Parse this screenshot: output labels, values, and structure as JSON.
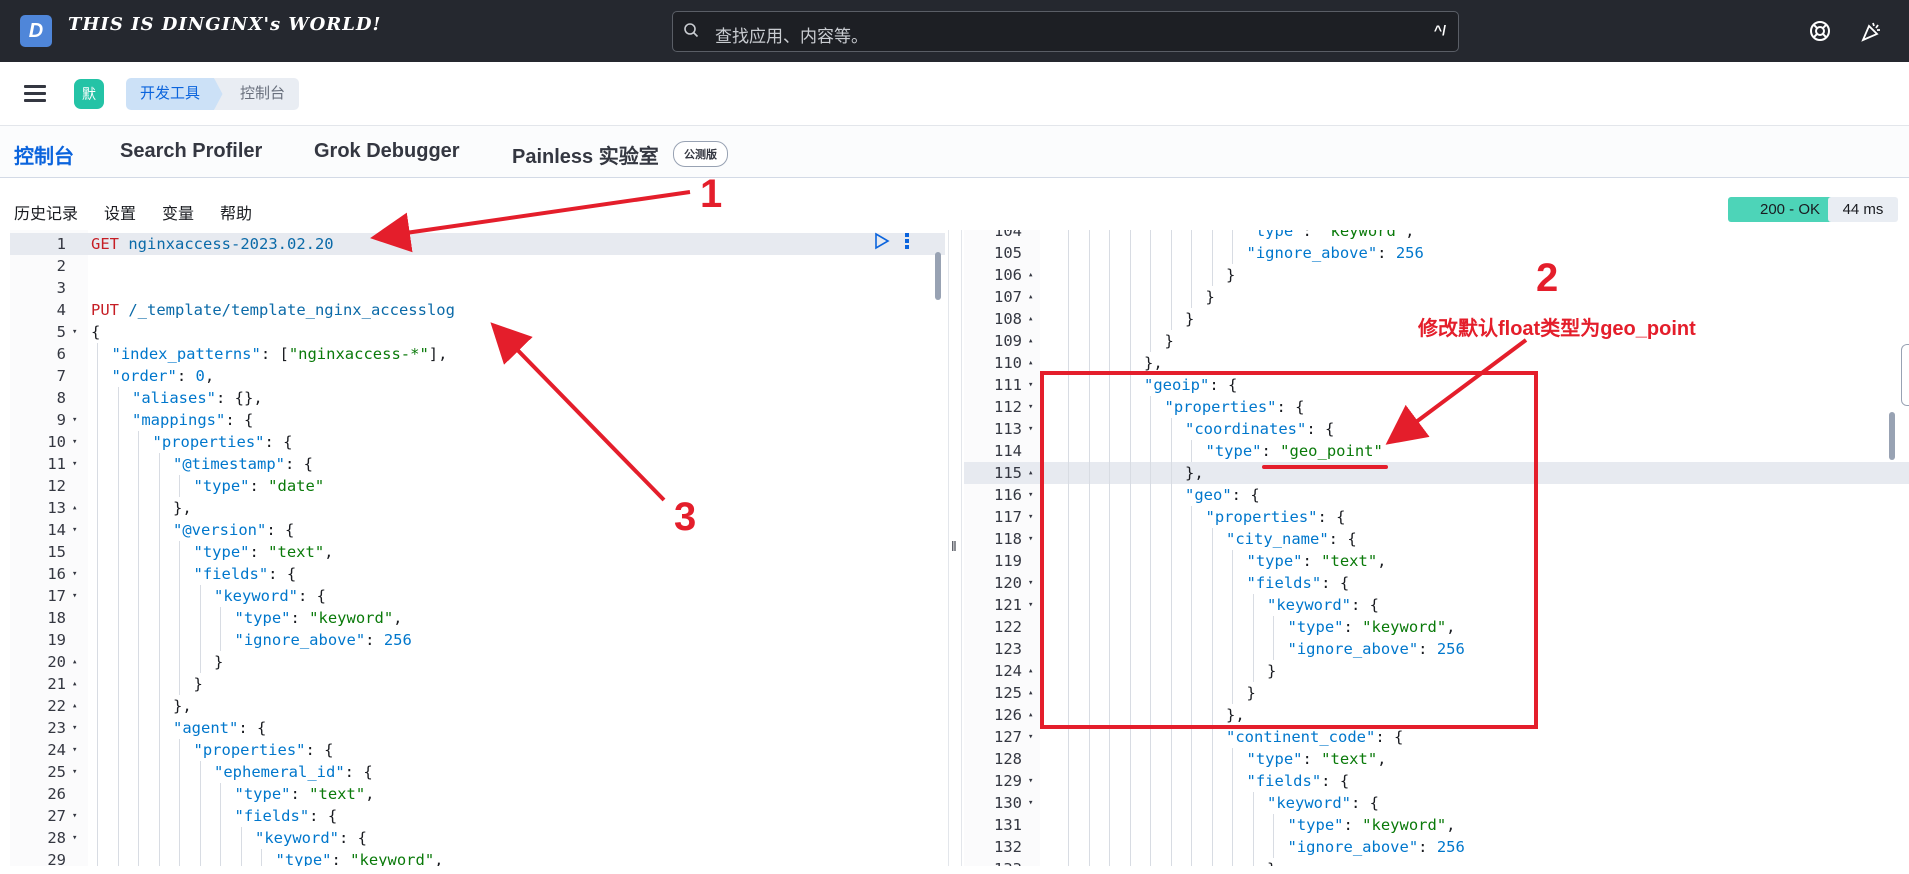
{
  "app": {
    "site_title": "THIS IS DINGINX's WORLD!",
    "logo_letter": "D",
    "search_placeholder": "查找应用、内容等。",
    "search_shortcut": "^/"
  },
  "nav": {
    "avatar": "默",
    "breadcrumbs": [
      "开发工具",
      "控制台"
    ]
  },
  "tabs": [
    {
      "label": "控制台",
      "active": true
    },
    {
      "label": "Search Profiler"
    },
    {
      "label": "Grok Debugger"
    },
    {
      "label": "Painless 实验室"
    }
  ],
  "beta_badge": "公测版",
  "toolbar": {
    "items": [
      "历史记录",
      "设置",
      "变量",
      "帮助"
    ]
  },
  "response": {
    "status": "200 - OK",
    "time": "44 ms"
  },
  "annotations": {
    "one": "1",
    "two": "2",
    "three": "3",
    "note": "修改默认float类型为geo_point"
  },
  "request_lines": [
    {
      "n": "1",
      "fold": "",
      "indent": 0,
      "html": "<span class='m'>GET</span> <span class='p'>nginxaccess-2023.02.20</span>"
    },
    {
      "n": "2",
      "fold": "",
      "indent": 0,
      "html": ""
    },
    {
      "n": "3",
      "fold": "",
      "indent": 0,
      "html": ""
    },
    {
      "n": "4",
      "fold": "",
      "indent": 0,
      "html": "<span class='m'>PUT</span> <span class='p'>/_template/template_nginx_accesslog</span>"
    },
    {
      "n": "5",
      "fold": "▾",
      "indent": 0,
      "html": "{"
    },
    {
      "n": "6",
      "fold": "",
      "indent": 1,
      "html": "<span class='n'>\"index_patterns\"</span>: [<span class='s'>\"nginxaccess-*\"</span>],"
    },
    {
      "n": "7",
      "fold": "",
      "indent": 1,
      "html": "<span class='n'>\"order\"</span>: <span class='n'>0</span>,"
    },
    {
      "n": "8",
      "fold": "",
      "indent": 2,
      "html": "<span class='n'>\"aliases\"</span>: {},"
    },
    {
      "n": "9",
      "fold": "▾",
      "indent": 2,
      "html": "<span class='n'>\"mappings\"</span>: {"
    },
    {
      "n": "10",
      "fold": "▾",
      "indent": 3,
      "html": "<span class='n'>\"properties\"</span>: {"
    },
    {
      "n": "11",
      "fold": "▾",
      "indent": 4,
      "html": "<span class='n'>\"@timestamp\"</span>: {"
    },
    {
      "n": "12",
      "fold": "",
      "indent": 5,
      "html": "<span class='n'>\"type\"</span>: <span class='s'>\"date\"</span>"
    },
    {
      "n": "13",
      "fold": "▴",
      "indent": 4,
      "html": "},"
    },
    {
      "n": "14",
      "fold": "▾",
      "indent": 4,
      "html": "<span class='n'>\"@version\"</span>: {"
    },
    {
      "n": "15",
      "fold": "",
      "indent": 5,
      "html": "<span class='n'>\"type\"</span>: <span class='s'>\"text\"</span>,"
    },
    {
      "n": "16",
      "fold": "▾",
      "indent": 5,
      "html": "<span class='n'>\"fields\"</span>: {"
    },
    {
      "n": "17",
      "fold": "▾",
      "indent": 6,
      "html": "<span class='n'>\"keyword\"</span>: {"
    },
    {
      "n": "18",
      "fold": "",
      "indent": 7,
      "html": "<span class='n'>\"type\"</span>: <span class='s'>\"keyword\"</span>,"
    },
    {
      "n": "19",
      "fold": "",
      "indent": 7,
      "html": "<span class='n'>\"ignore_above\"</span>: <span class='n'>256</span>"
    },
    {
      "n": "20",
      "fold": "▴",
      "indent": 6,
      "html": "}"
    },
    {
      "n": "21",
      "fold": "▴",
      "indent": 5,
      "html": "}"
    },
    {
      "n": "22",
      "fold": "▴",
      "indent": 4,
      "html": "},"
    },
    {
      "n": "23",
      "fold": "▾",
      "indent": 4,
      "html": "<span class='n'>\"agent\"</span>: {"
    },
    {
      "n": "24",
      "fold": "▾",
      "indent": 5,
      "html": "<span class='n'>\"properties\"</span>: {"
    },
    {
      "n": "25",
      "fold": "▾",
      "indent": 6,
      "html": "<span class='n'>\"ephemeral_id\"</span>: {"
    },
    {
      "n": "26",
      "fold": "",
      "indent": 7,
      "html": "<span class='n'>\"type\"</span>: <span class='s'>\"text\"</span>,"
    },
    {
      "n": "27",
      "fold": "▾",
      "indent": 7,
      "html": "<span class='n'>\"fields\"</span>: {"
    },
    {
      "n": "28",
      "fold": "▾",
      "indent": 8,
      "html": "<span class='n'>\"keyword\"</span>: {"
    },
    {
      "n": "29",
      "fold": "",
      "indent": 9,
      "html": "<span class='n'>\"type\"</span>: <span class='s'>\"keyword\"</span>,"
    }
  ],
  "response_lines": [
    {
      "n": "104",
      "fold": "",
      "indent": 9,
      "html": "<span class='n'>\"type\"</span>: <span class='s'>\"keyword\"</span>,"
    },
    {
      "n": "105",
      "fold": "",
      "indent": 9,
      "html": "<span class='n'>\"ignore_above\"</span>: <span class='n'>256</span>"
    },
    {
      "n": "106",
      "fold": "▴",
      "indent": 8,
      "html": "}"
    },
    {
      "n": "107",
      "fold": "▴",
      "indent": 7,
      "html": "}"
    },
    {
      "n": "108",
      "fold": "▴",
      "indent": 6,
      "html": "}"
    },
    {
      "n": "109",
      "fold": "▴",
      "indent": 5,
      "html": "}"
    },
    {
      "n": "110",
      "fold": "▴",
      "indent": 4,
      "html": "},"
    },
    {
      "n": "111",
      "fold": "▾",
      "indent": 4,
      "html": "<span class='n'>\"geoip\"</span>: {"
    },
    {
      "n": "112",
      "fold": "▾",
      "indent": 5,
      "html": "<span class='n'>\"properties\"</span>: {"
    },
    {
      "n": "113",
      "fold": "▾",
      "indent": 6,
      "html": "<span class='n'>\"coordinates\"</span>: {"
    },
    {
      "n": "114",
      "fold": "",
      "indent": 7,
      "html": "<span class='n'>\"type\"</span>: <span class='s'>\"geo_point\"</span>"
    },
    {
      "n": "115",
      "fold": "▴",
      "indent": 6,
      "html": "},",
      "hl": true
    },
    {
      "n": "116",
      "fold": "▾",
      "indent": 6,
      "html": "<span class='n'>\"geo\"</span>: {"
    },
    {
      "n": "117",
      "fold": "▾",
      "indent": 7,
      "html": "<span class='n'>\"properties\"</span>: {"
    },
    {
      "n": "118",
      "fold": "▾",
      "indent": 8,
      "html": "<span class='n'>\"city_name\"</span>: {"
    },
    {
      "n": "119",
      "fold": "",
      "indent": 9,
      "html": "<span class='n'>\"type\"</span>: <span class='s'>\"text\"</span>,"
    },
    {
      "n": "120",
      "fold": "▾",
      "indent": 9,
      "html": "<span class='n'>\"fields\"</span>: {"
    },
    {
      "n": "121",
      "fold": "▾",
      "indent": 10,
      "html": "<span class='n'>\"keyword\"</span>: {"
    },
    {
      "n": "122",
      "fold": "",
      "indent": 11,
      "html": "<span class='n'>\"type\"</span>: <span class='s'>\"keyword\"</span>,"
    },
    {
      "n": "123",
      "fold": "",
      "indent": 11,
      "html": "<span class='n'>\"ignore_above\"</span>: <span class='n'>256</span>"
    },
    {
      "n": "124",
      "fold": "▴",
      "indent": 10,
      "html": "}"
    },
    {
      "n": "125",
      "fold": "▴",
      "indent": 9,
      "html": "}"
    },
    {
      "n": "126",
      "fold": "▴",
      "indent": 8,
      "html": "},"
    },
    {
      "n": "127",
      "fold": "▾",
      "indent": 8,
      "html": "<span class='n'>\"continent_code\"</span>: {"
    },
    {
      "n": "128",
      "fold": "",
      "indent": 9,
      "html": "<span class='n'>\"type\"</span>: <span class='s'>\"text\"</span>,"
    },
    {
      "n": "129",
      "fold": "▾",
      "indent": 9,
      "html": "<span class='n'>\"fields\"</span>: {"
    },
    {
      "n": "130",
      "fold": "▾",
      "indent": 10,
      "html": "<span class='n'>\"keyword\"</span>: {"
    },
    {
      "n": "131",
      "fold": "",
      "indent": 11,
      "html": "<span class='n'>\"type\"</span>: <span class='s'>\"keyword\"</span>,"
    },
    {
      "n": "132",
      "fold": "",
      "indent": 11,
      "html": "<span class='n'>\"ignore_above\"</span>: <span class='n'>256</span>"
    },
    {
      "n": "133",
      "fold": "▴",
      "indent": 10,
      "html": "}"
    }
  ]
}
